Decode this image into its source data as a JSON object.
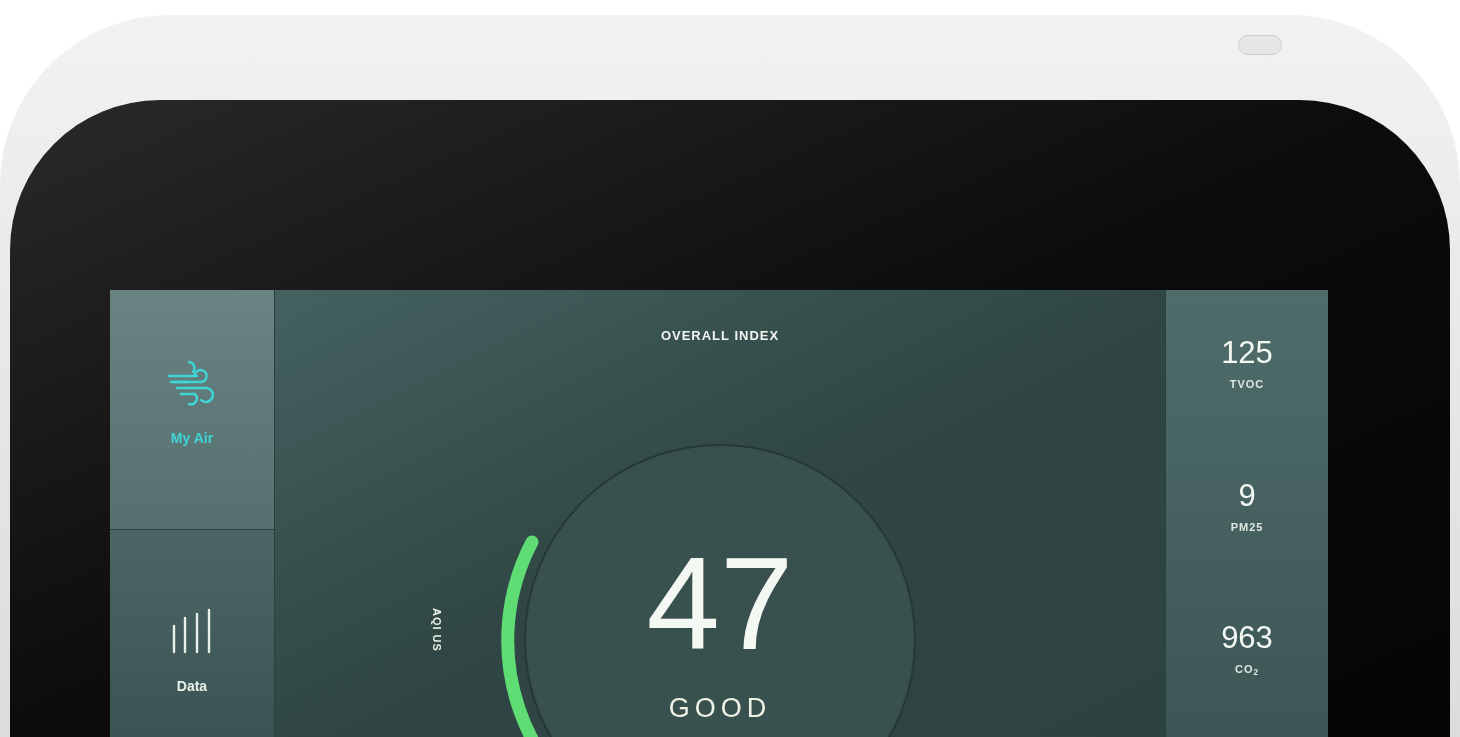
{
  "sidebar": {
    "items": [
      {
        "label": "My Air",
        "kind": "wind",
        "selected": true
      },
      {
        "label": "Data",
        "kind": "bars",
        "selected": false
      }
    ]
  },
  "main": {
    "title": "OVERALL INDEX",
    "scale": "AQI US",
    "value": "47",
    "status": "GOOD"
  },
  "metrics": [
    {
      "value": "125",
      "label": "TVOC"
    },
    {
      "value": "9",
      "label": "PM25"
    },
    {
      "value": "963",
      "label": "CO$_{2}$"
    }
  ]
}
